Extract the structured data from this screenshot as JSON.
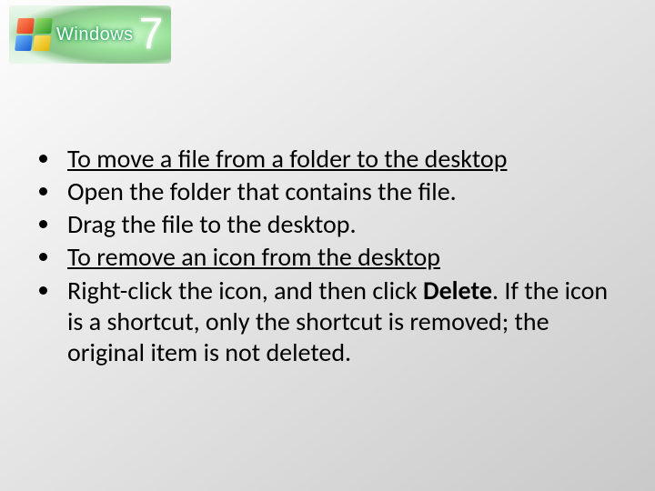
{
  "logo": {
    "brand": "Windows",
    "version": "7"
  },
  "bullets": {
    "b1": "To move a file from a folder to the desktop",
    "b2": "Open the folder that contains the file.",
    "b3": "Drag the file to the desktop.",
    "b4": "To remove an icon from the desktop",
    "b5_pre": "Right-click the icon, and then click ",
    "b5_bold": "Delete",
    "b5_post": ". If the icon is a shortcut, only the shortcut is removed; the original item is not deleted."
  }
}
